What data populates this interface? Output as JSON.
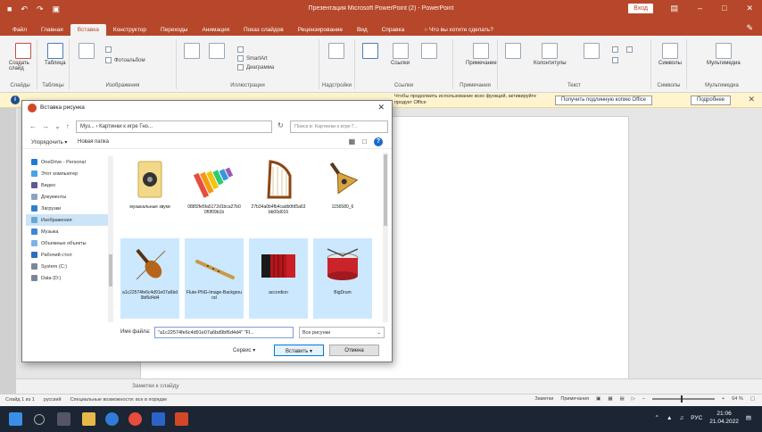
{
  "titlebar": {
    "title": "Презентация Microsoft PowerPoint (2) - PowerPoint",
    "signin": "Вход"
  },
  "tabs": [
    {
      "label": "Файл"
    },
    {
      "label": "Главная"
    },
    {
      "label": "Вставка"
    },
    {
      "label": "Конструктор"
    },
    {
      "label": "Переходы"
    },
    {
      "label": "Анимация"
    },
    {
      "label": "Показ слайдов"
    },
    {
      "label": "Рецензирование"
    },
    {
      "label": "Вид"
    },
    {
      "label": "Справка"
    }
  ],
  "tellme": "Что вы хотите сделать?",
  "ribbon": {
    "groups": [
      {
        "label": "Слайды"
      },
      {
        "label": "Таблицы"
      },
      {
        "label": "Изображения"
      },
      {
        "label": "Иллюстрации"
      },
      {
        "label": "Надстройки"
      },
      {
        "label": "Ссылки"
      },
      {
        "label": "Примечания"
      },
      {
        "label": "Текст"
      },
      {
        "label": "Символы"
      },
      {
        "label": "Мультимедиа"
      }
    ],
    "buttons": {
      "new_slide": "Создать слайд",
      "table": "Таблица",
      "photo_album": "Фотоальбом",
      "smartart": "SmartArt",
      "chart": "Диаграмма",
      "links": "Ссылки",
      "comment": "Примечание",
      "header_footer": "Колонтитулы",
      "symbols": "Символы",
      "media": "Мультимедиа"
    }
  },
  "notify": {
    "message": "Чтобы продолжить использование всех функций, активируйте продукт Office",
    "btn1": "Получить подлинную копию Office",
    "btn2": "Подробнее"
  },
  "notes": "Заметки к слайду",
  "statusbar": {
    "slide": "Слайд 1 из 1",
    "lang": "русский",
    "accessibility": "Специальные возможности: все в порядке",
    "notes": "Заметки",
    "comments": "Примечания",
    "zoom": "64 %"
  },
  "taskbar": {
    "lang": "РУС",
    "time": "21:06",
    "date": "21.04.2022"
  },
  "dialog": {
    "title": "Вставка рисунка",
    "path": "Муз... › Картинки к игре Гно...",
    "search_placeholder": "Поиск в: Картинки к игре Г...",
    "organize": "Упорядочить ▾",
    "new_folder": "Новая папка",
    "tree": [
      {
        "label": "OneDrive - Personal"
      },
      {
        "label": "Этот компьютер"
      },
      {
        "label": "Видео"
      },
      {
        "label": "Документы"
      },
      {
        "label": "Загрузки"
      },
      {
        "label": "Изображения"
      },
      {
        "label": "Музыка"
      },
      {
        "label": "Объемные объекты"
      },
      {
        "label": "Рабочий стол"
      },
      {
        "label": "System (C:)"
      },
      {
        "label": "Data (D:)"
      }
    ],
    "files": [
      {
        "name": "музыкальные звуки",
        "selected": false
      },
      {
        "name": "088f2fe5fa5172d1bca27b00f0f09b1b",
        "selected": false
      },
      {
        "name": "27b34a0b4fb4cadb0fd5a63bb00d016",
        "selected": false
      },
      {
        "name": "1156580_6",
        "selected": false
      },
      {
        "name": "a1c22574fe6c4d91e07a6bd9bf6d4d4",
        "selected": true
      },
      {
        "name": "Flute-PNG-Image-Background",
        "selected": true
      },
      {
        "name": "accordion",
        "selected": true
      },
      {
        "name": "BigDrum",
        "selected": true
      }
    ],
    "filename_label": "Имя файла:",
    "filename_value": "\"a1c22574fe6c4d91e07a6bd9bf6d4d4\" \"Fl...",
    "filetype": "Все рисунки",
    "service": "Сервис",
    "insert": "Вставить",
    "cancel": "Отмена"
  }
}
